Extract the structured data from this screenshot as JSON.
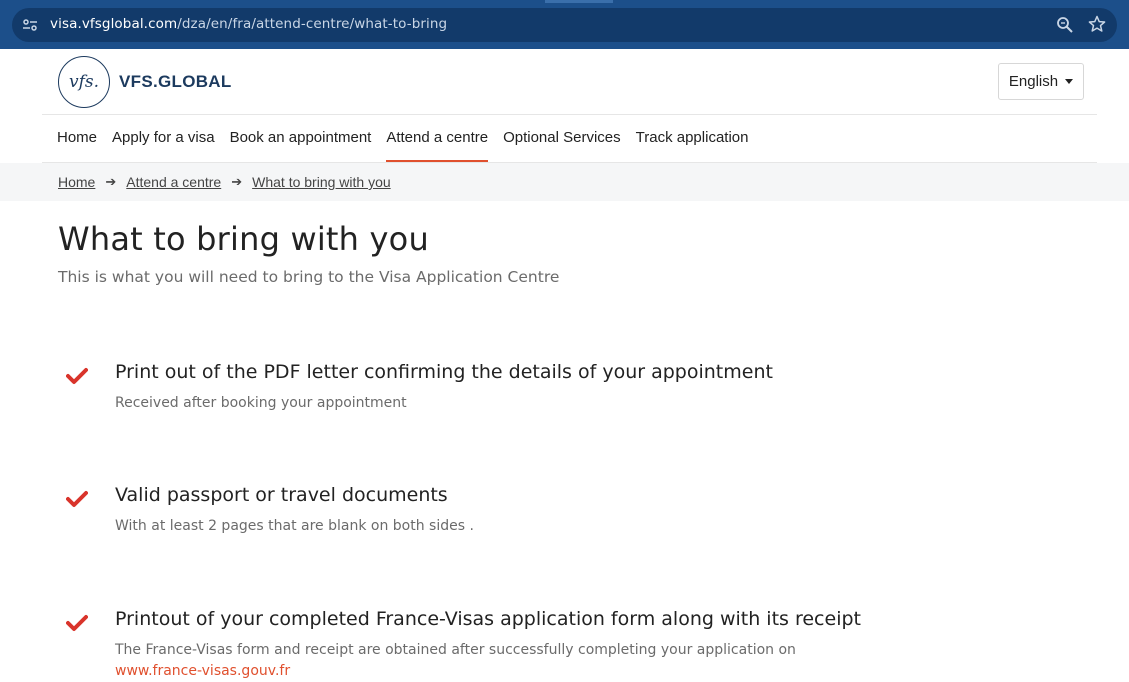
{
  "browser": {
    "url_host": "visa.vfsglobal.com",
    "url_path": "/dza/en/fra/attend-centre/what-to-bring"
  },
  "header": {
    "logo_mark": "vfs.",
    "logo_text": "VFS.GLOBAL",
    "language_label": "English"
  },
  "nav": {
    "items": [
      {
        "label": "Home"
      },
      {
        "label": "Apply for a visa"
      },
      {
        "label": "Book an appointment"
      },
      {
        "label": "Attend a centre",
        "active": true
      },
      {
        "label": "Optional Services"
      },
      {
        "label": "Track application"
      }
    ]
  },
  "breadcrumb": {
    "items": [
      "Home",
      "Attend a centre",
      "What to bring with you"
    ]
  },
  "main": {
    "title": "What to bring with you",
    "subtitle": "This is what you will need to bring to the Visa Application Centre",
    "items": [
      {
        "title": "Print out of the PDF letter confirming the details of your appointment",
        "desc": "Received after booking your appointment"
      },
      {
        "title": "Valid passport or travel documents",
        "desc": "With at least 2 pages that are blank on both sides ."
      },
      {
        "title": "Printout of your completed France-Visas application form along with its receipt",
        "desc": "The France-Visas form and receipt are obtained after successfully completing your application on",
        "link": "www.france-visas.gouv.fr"
      }
    ]
  },
  "colors": {
    "browser_bar": "#1c4f8a",
    "accent": "#e0502e",
    "brand_navy": "#1c3a5e",
    "check": "#d9342b"
  },
  "icons": [
    "site-info-icon",
    "zoom-icon",
    "star-icon",
    "check-icon",
    "arrow-right-icon",
    "caret-down-icon"
  ]
}
